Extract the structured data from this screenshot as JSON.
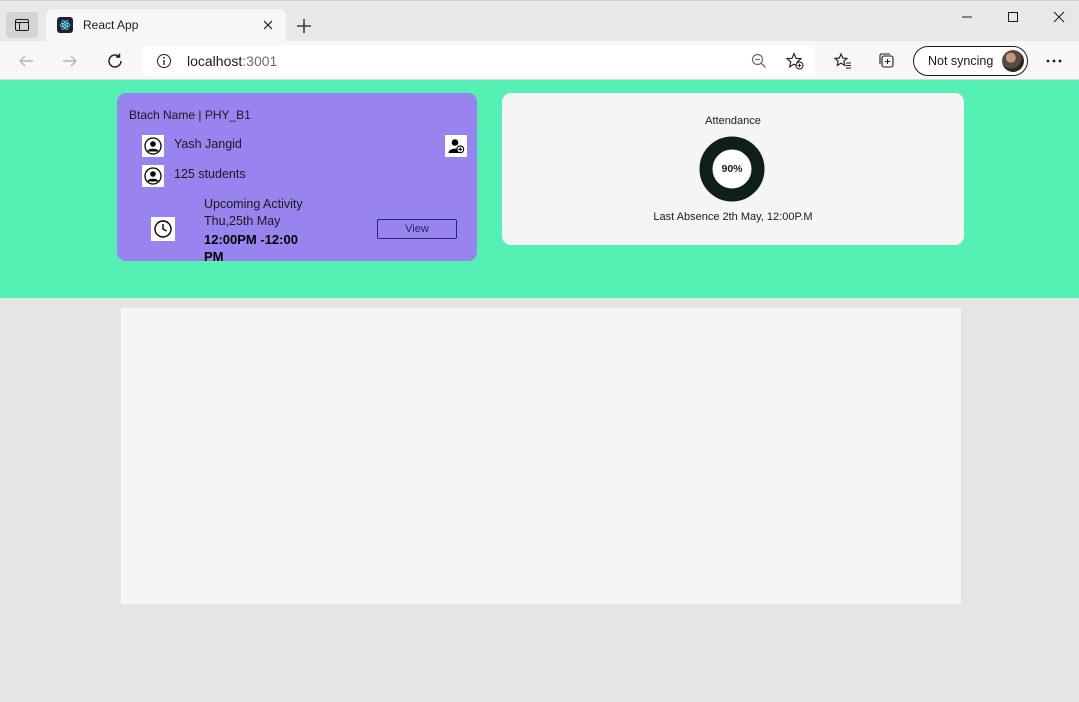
{
  "browser": {
    "tab_title": "React App",
    "url_host": "localhost",
    "url_port": ":3001",
    "sync_label": "Not syncing"
  },
  "batch_card": {
    "title": "Btach Name | PHY_B1",
    "instructor": "Yash Jangid",
    "students": "125 students",
    "activity_title": "Upcoming Activity",
    "activity_date": "Thu,25th May",
    "activity_time": "12:00PM -12:00 PM",
    "view_label": "View",
    "accent_color": "#9883ef"
  },
  "attendance_card": {
    "title": "Attendance",
    "percent_label": "90%",
    "percent_value": 90,
    "last_absence": "Last Absence 2th May, 12:00P.M",
    "ring_color": "#0d1f17"
  },
  "colors": {
    "hero_bg": "#55f0b4",
    "page_bg": "#e5e5e5",
    "panel_bg": "#f5f5f5"
  }
}
